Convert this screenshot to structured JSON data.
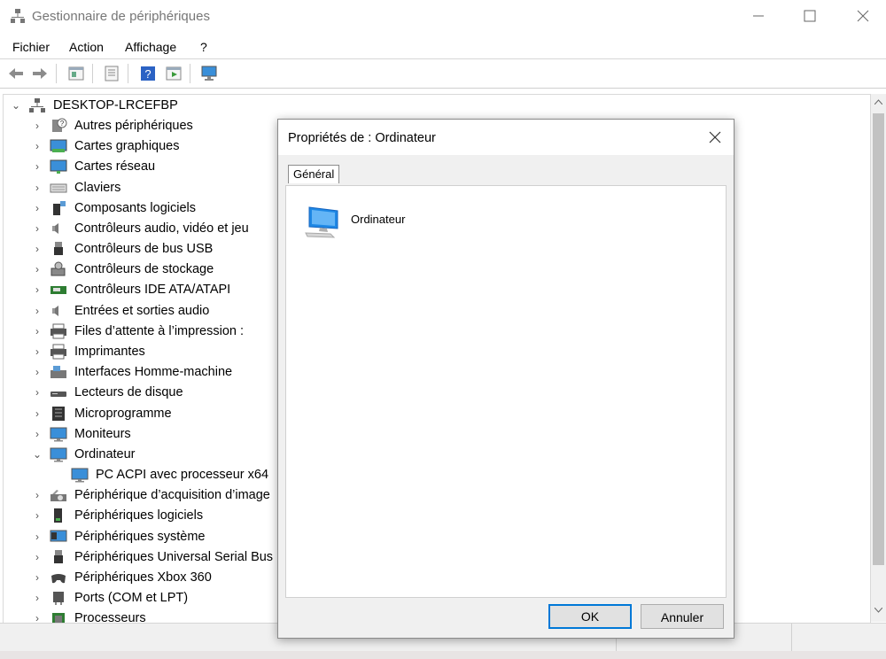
{
  "window": {
    "title": "Gestionnaire de périphériques"
  },
  "menu": {
    "items": [
      "Fichier",
      "Action",
      "Affichage",
      "?"
    ]
  },
  "toolbar": {
    "buttons": [
      "back-icon",
      "forward-icon",
      "properties-view-icon",
      "details-icon",
      "help-icon",
      "run-icon",
      "scan-hardware-icon"
    ]
  },
  "tree": {
    "root": "DESKTOP-LRCEFBP",
    "items": [
      {
        "label": "Autres périphériques",
        "icon": "unknown-device-icon"
      },
      {
        "label": "Cartes graphiques",
        "icon": "display-adapter-icon"
      },
      {
        "label": "Cartes réseau",
        "icon": "network-adapter-icon"
      },
      {
        "label": "Claviers",
        "icon": "keyboard-icon"
      },
      {
        "label": "Composants logiciels",
        "icon": "software-component-icon"
      },
      {
        "label": "Contrôleurs audio, vidéo et jeu",
        "icon": "speaker-icon"
      },
      {
        "label": "Contrôleurs de bus USB",
        "icon": "usb-icon"
      },
      {
        "label": "Contrôleurs de stockage",
        "icon": "storage-controller-icon"
      },
      {
        "label": "Contrôleurs IDE ATA/ATAPI",
        "icon": "ide-controller-icon"
      },
      {
        "label": "Entrées et sorties audio",
        "icon": "audio-io-icon"
      },
      {
        "label": "Files d’attente à l’impression :",
        "icon": "print-queue-icon"
      },
      {
        "label": "Imprimantes",
        "icon": "printer-icon"
      },
      {
        "label": "Interfaces Homme-machine",
        "icon": "hid-icon"
      },
      {
        "label": "Lecteurs de disque",
        "icon": "disk-drive-icon"
      },
      {
        "label": "Microprogramme",
        "icon": "firmware-icon"
      },
      {
        "label": "Moniteurs",
        "icon": "monitor-icon"
      },
      {
        "label": "Ordinateur",
        "icon": "computer-icon",
        "expanded": true
      },
      {
        "label": "PC ACPI avec processeur x64",
        "icon": "computer-icon",
        "child": true
      },
      {
        "label": "Périphérique d’acquisition d’image",
        "icon": "imaging-device-icon"
      },
      {
        "label": "Périphériques logiciels",
        "icon": "software-device-icon"
      },
      {
        "label": "Périphériques système",
        "icon": "system-device-icon"
      },
      {
        "label": "Périphériques Universal Serial Bus",
        "icon": "usb-device-icon"
      },
      {
        "label": "Périphériques Xbox 360",
        "icon": "gamepad-icon"
      },
      {
        "label": "Ports (COM et LPT)",
        "icon": "port-icon"
      },
      {
        "label": "Processeurs",
        "icon": "processor-icon"
      }
    ]
  },
  "dialog": {
    "title": "Propriétés de : Ordinateur",
    "tab": "Général",
    "device_name": "Ordinateur",
    "ok": "OK",
    "cancel": "Annuler"
  },
  "colors": {
    "accent": "#0078d7",
    "chrome": "#f0f0f0"
  }
}
